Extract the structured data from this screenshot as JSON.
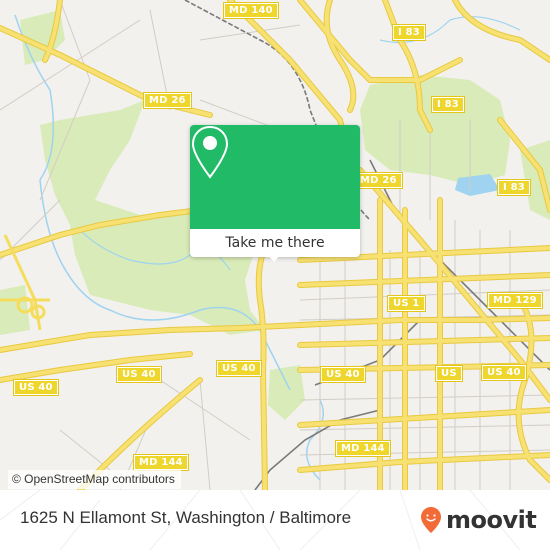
{
  "map": {
    "colors": {
      "background": "#f2f1ee",
      "park": "#d9ebb8",
      "water": "#9fd3f0",
      "road": "#f5dc5a",
      "road_edge": "#e8c940",
      "minor_road": "#c9c4bd",
      "rail": "#7a7a7a"
    },
    "shields": [
      {
        "label": "MD 140",
        "id": "md-140"
      },
      {
        "label": "I 83",
        "id": "i-83-north"
      },
      {
        "label": "MD 26",
        "id": "md-26-west"
      },
      {
        "label": "I 83",
        "id": "i-83-center"
      },
      {
        "label": "MD 26",
        "id": "md-26-east"
      },
      {
        "label": "I 83",
        "id": "i-83-east"
      },
      {
        "label": "US 1",
        "id": "us-1"
      },
      {
        "label": "MD 129",
        "id": "md-129"
      },
      {
        "label": "US 40",
        "id": "us-40-west"
      },
      {
        "label": "US 40",
        "id": "us-40-center"
      },
      {
        "label": "US 40",
        "id": "us-40-mid"
      },
      {
        "label": "US 40",
        "id": "us-40-east"
      },
      {
        "label": "US 40",
        "id": "us-40-far-east"
      },
      {
        "label": "US",
        "id": "us-partial"
      },
      {
        "label": "MD 144",
        "id": "md-144-west"
      },
      {
        "label": "MD 144",
        "id": "md-144-east"
      }
    ],
    "attribution": "© OpenStreetMap contributors"
  },
  "popup": {
    "icon": "map-pin-icon",
    "button_label": "Take me there",
    "accent_color": "#21ba67"
  },
  "footer": {
    "address": "1625 N Ellamont St, Washington / Baltimore",
    "brand": {
      "name": "moovit",
      "icon": "moovit-logo-icon",
      "color": "#f26a36"
    }
  }
}
